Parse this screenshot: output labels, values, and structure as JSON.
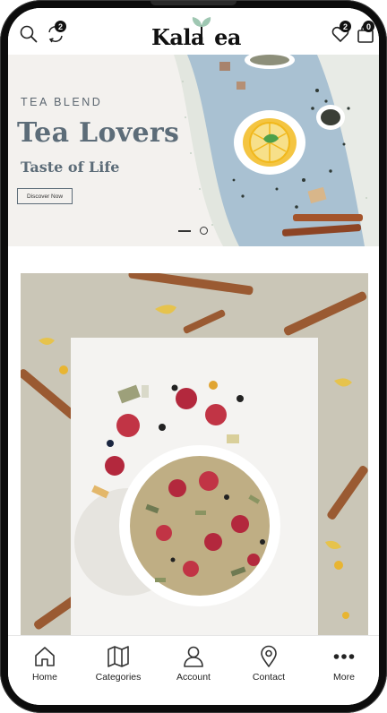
{
  "header": {
    "logo_text_1": "Kala",
    "logo_text_2": "ea",
    "compare_count": "2",
    "wishlist_count": "2",
    "cart_count": "0",
    "icons": [
      "search-icon",
      "compare-icon",
      "heart-icon",
      "bag-icon"
    ]
  },
  "hero": {
    "eyebrow": "TEA BLEND",
    "title": "Tea Lovers",
    "subtitle": "Taste of Life",
    "button_label": "Discover Now"
  },
  "nav": {
    "items": [
      {
        "label": "Home",
        "icon": "home-icon"
      },
      {
        "label": "Categories",
        "icon": "map-icon"
      },
      {
        "label": "Account",
        "icon": "user-icon"
      },
      {
        "label": "Contact",
        "icon": "location-pin-icon"
      },
      {
        "label": "More",
        "icon": "more-dots-icon"
      }
    ]
  },
  "colors": {
    "accent": "#5c6c78",
    "product_bg": "#cac6b7"
  }
}
